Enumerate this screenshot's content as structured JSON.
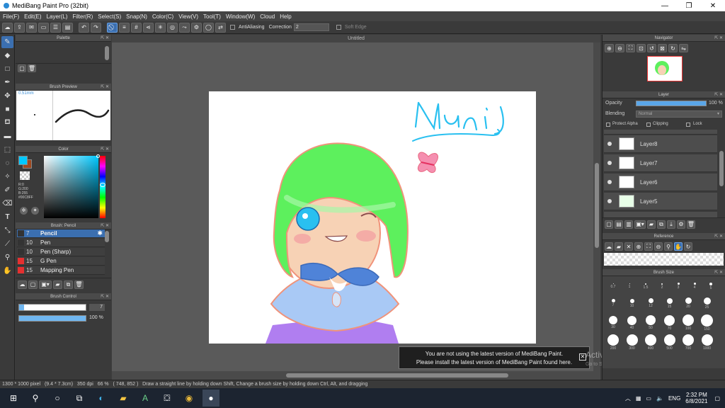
{
  "window": {
    "title": "MediBang Paint Pro (32bit)",
    "min": "—",
    "max": "❐",
    "close": "✕"
  },
  "menu": [
    "File(F)",
    "Edit(E)",
    "Layer(L)",
    "Filter(R)",
    "Select(S)",
    "Snap(N)",
    "Color(C)",
    "View(V)",
    "Tool(T)",
    "Window(W)",
    "Cloud",
    "Help"
  ],
  "toolbar": {
    "antialias_label": "AntiAliasing",
    "correction_label": "Correction",
    "correction_value": "2",
    "soft_edge_label": "Soft Edge"
  },
  "panels": {
    "palette": "Palette",
    "brush_preview": "Brush Preview",
    "brush_preview_size": "0.51mm",
    "color": "Color",
    "brush_list_title": "Brush: Pencil",
    "brush_control": "Brush Control",
    "navigator": "Navigator",
    "layer": "Layer",
    "reference": "Reference",
    "brush_size": "Brush Size"
  },
  "color": {
    "fg_hex": "#00C8FF",
    "rgb_r": "R:0",
    "rgb_g": "G:200",
    "rgb_b": "B:255",
    "hex_label": "#00C8FF"
  },
  "brushes": [
    {
      "size": "7",
      "name": "Pencil",
      "color": "#333333",
      "selected": true
    },
    {
      "size": "10",
      "name": "Pen",
      "color": "#333333",
      "selected": false
    },
    {
      "size": "10",
      "name": "Pen (Sharp)",
      "color": "#333333",
      "selected": false
    },
    {
      "size": "15",
      "name": "G Pen",
      "color": "#e53030",
      "selected": false
    },
    {
      "size": "15",
      "name": "Mapping Pen",
      "color": "#e53030",
      "selected": false
    }
  ],
  "brush_control": {
    "size_value": "7",
    "opacity_value": "100 %",
    "size_fraction": 0.07,
    "opacity_fraction": 1.0
  },
  "document": {
    "tab_title": "Untitled",
    "signature": "Muni"
  },
  "layer_panel": {
    "opacity_label": "Opacity",
    "opacity_value": "100 %",
    "blending_label": "Blending",
    "blending_value": "Normal",
    "protect_alpha": "Protect Alpha",
    "clipping": "Clipping",
    "lock": "Lock",
    "layers": [
      "Layer8",
      "Layer7",
      "Layer6",
      "Layer5"
    ]
  },
  "brush_sizes": [
    [
      "0.7",
      "1",
      "1.5",
      "2",
      "3",
      "4",
      "5"
    ],
    [
      "7",
      "10",
      "12",
      "15",
      "20",
      "25"
    ],
    [
      "30",
      "40",
      "50",
      "70",
      "100",
      "150"
    ],
    [
      "200",
      "300",
      "400",
      "500",
      "700",
      "1000"
    ]
  ],
  "notification": {
    "line1": "You are not using the latest version of MediBang Paint.",
    "line2": "Please install the latest version of MediBang Paint found here.",
    "close": "✕"
  },
  "watermark": {
    "line1": "Activate Windows",
    "line2": "Go to Settings to activate Windows."
  },
  "status": {
    "doc_size": "1300 * 1000 pixel",
    "phys_size": "(9.4 * 7.3cm)",
    "dpi": "350 dpi",
    "zoom": "66 %",
    "coords": "( 748, 852 )",
    "hint": "Draw a straight line by holding down Shift, Change a brush size by holding down Ctrl, Alt, and dragging"
  },
  "taskbar": {
    "lang": "ENG",
    "time": "2:32 PM",
    "date": "6/8/2021"
  }
}
